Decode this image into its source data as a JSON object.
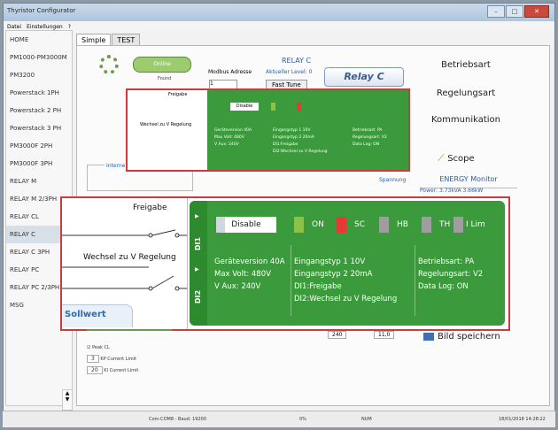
{
  "window": {
    "title": "Thyristor Configurator",
    "menu": [
      "Datei",
      "Einstellungen",
      "?"
    ]
  },
  "sidebar": {
    "items": [
      {
        "label": "HOME"
      },
      {
        "label": "PM1000-PM3000M"
      },
      {
        "label": "PM3200"
      },
      {
        "label": "Powerstack 1PH"
      },
      {
        "label": "Powerstack 2 PH"
      },
      {
        "label": "Powerstack 3 PH"
      },
      {
        "label": "PM3000F 2PH"
      },
      {
        "label": "PM3000F 3PH"
      },
      {
        "label": "RELAY M"
      },
      {
        "label": "RELAY M 2/3PH"
      },
      {
        "label": "RELAY CL"
      },
      {
        "label": "RELAY C"
      },
      {
        "label": "RELAY C 3PH"
      },
      {
        "label": "RELAY PC"
      },
      {
        "label": "RELAY PC 2/3PH"
      },
      {
        "label": "MSG"
      }
    ]
  },
  "tabs": [
    "Simple",
    "TEST"
  ],
  "header": {
    "online_label": "Online",
    "found_label": "Found",
    "modbus_label": "Modbus Adresse",
    "modbus_value": "1",
    "aktueller_level": "Aktueller Level: 0",
    "relay_title": "RELAY C",
    "relay_logo": "Relay C",
    "fast_tune": "Fast Tune"
  },
  "right_menu": {
    "betriebsart": "Betriebsart",
    "regelungsart": "Regelungsart",
    "kommunikation": "Kommunikation",
    "scope": "Scope",
    "energy_monitor": "ENERGY Monitor",
    "power": "Power: 3.73kVA   3.66kW",
    "bild_speichern": "Bild speichern"
  },
  "middle": {
    "interner_sollwert": "Interner Sollwert",
    "spannung": "Spannung",
    "input_240": "240",
    "input_11": "11,0",
    "peak_cl": "Peak CL",
    "kp_label": "KP Current Limit",
    "kp_value": "3",
    "ki_label": "KI Current Limit",
    "ki_value": "20"
  },
  "zoom": {
    "freigabe": "Freigabe",
    "wechsel": "Wechsel zu V Regelung",
    "sollwert": "Sollwert",
    "di1": "DI1",
    "di2": "DI2",
    "disable": "Disable",
    "indicators": [
      {
        "label": "ON",
        "color": "#8bc34a"
      },
      {
        "label": "SC",
        "color": "#e53935"
      },
      {
        "label": "HB",
        "color": "#9e9e9e"
      },
      {
        "label": "TH",
        "color": "#9e9e9e"
      },
      {
        "label": "I Lim",
        "color": "#9e9e9e"
      }
    ],
    "col1": [
      "Geräteversion 40A",
      "Max Volt: 480V",
      "V Aux: 240V"
    ],
    "col2": [
      "Eingangstyp 1 10V",
      "Eingangstyp 2 20mA",
      "DI1:Freigabe",
      "DI2:Wechsel zu V Regelung"
    ],
    "col3": [
      "Betriebsart: PA",
      "Regelungsart: V2",
      "Data Log: ON"
    ]
  },
  "status": {
    "com": "Com:COM8 - Baud: 19200",
    "percent": "0%",
    "num": "NUM",
    "datetime": "18/01/2018 14:28:22"
  }
}
